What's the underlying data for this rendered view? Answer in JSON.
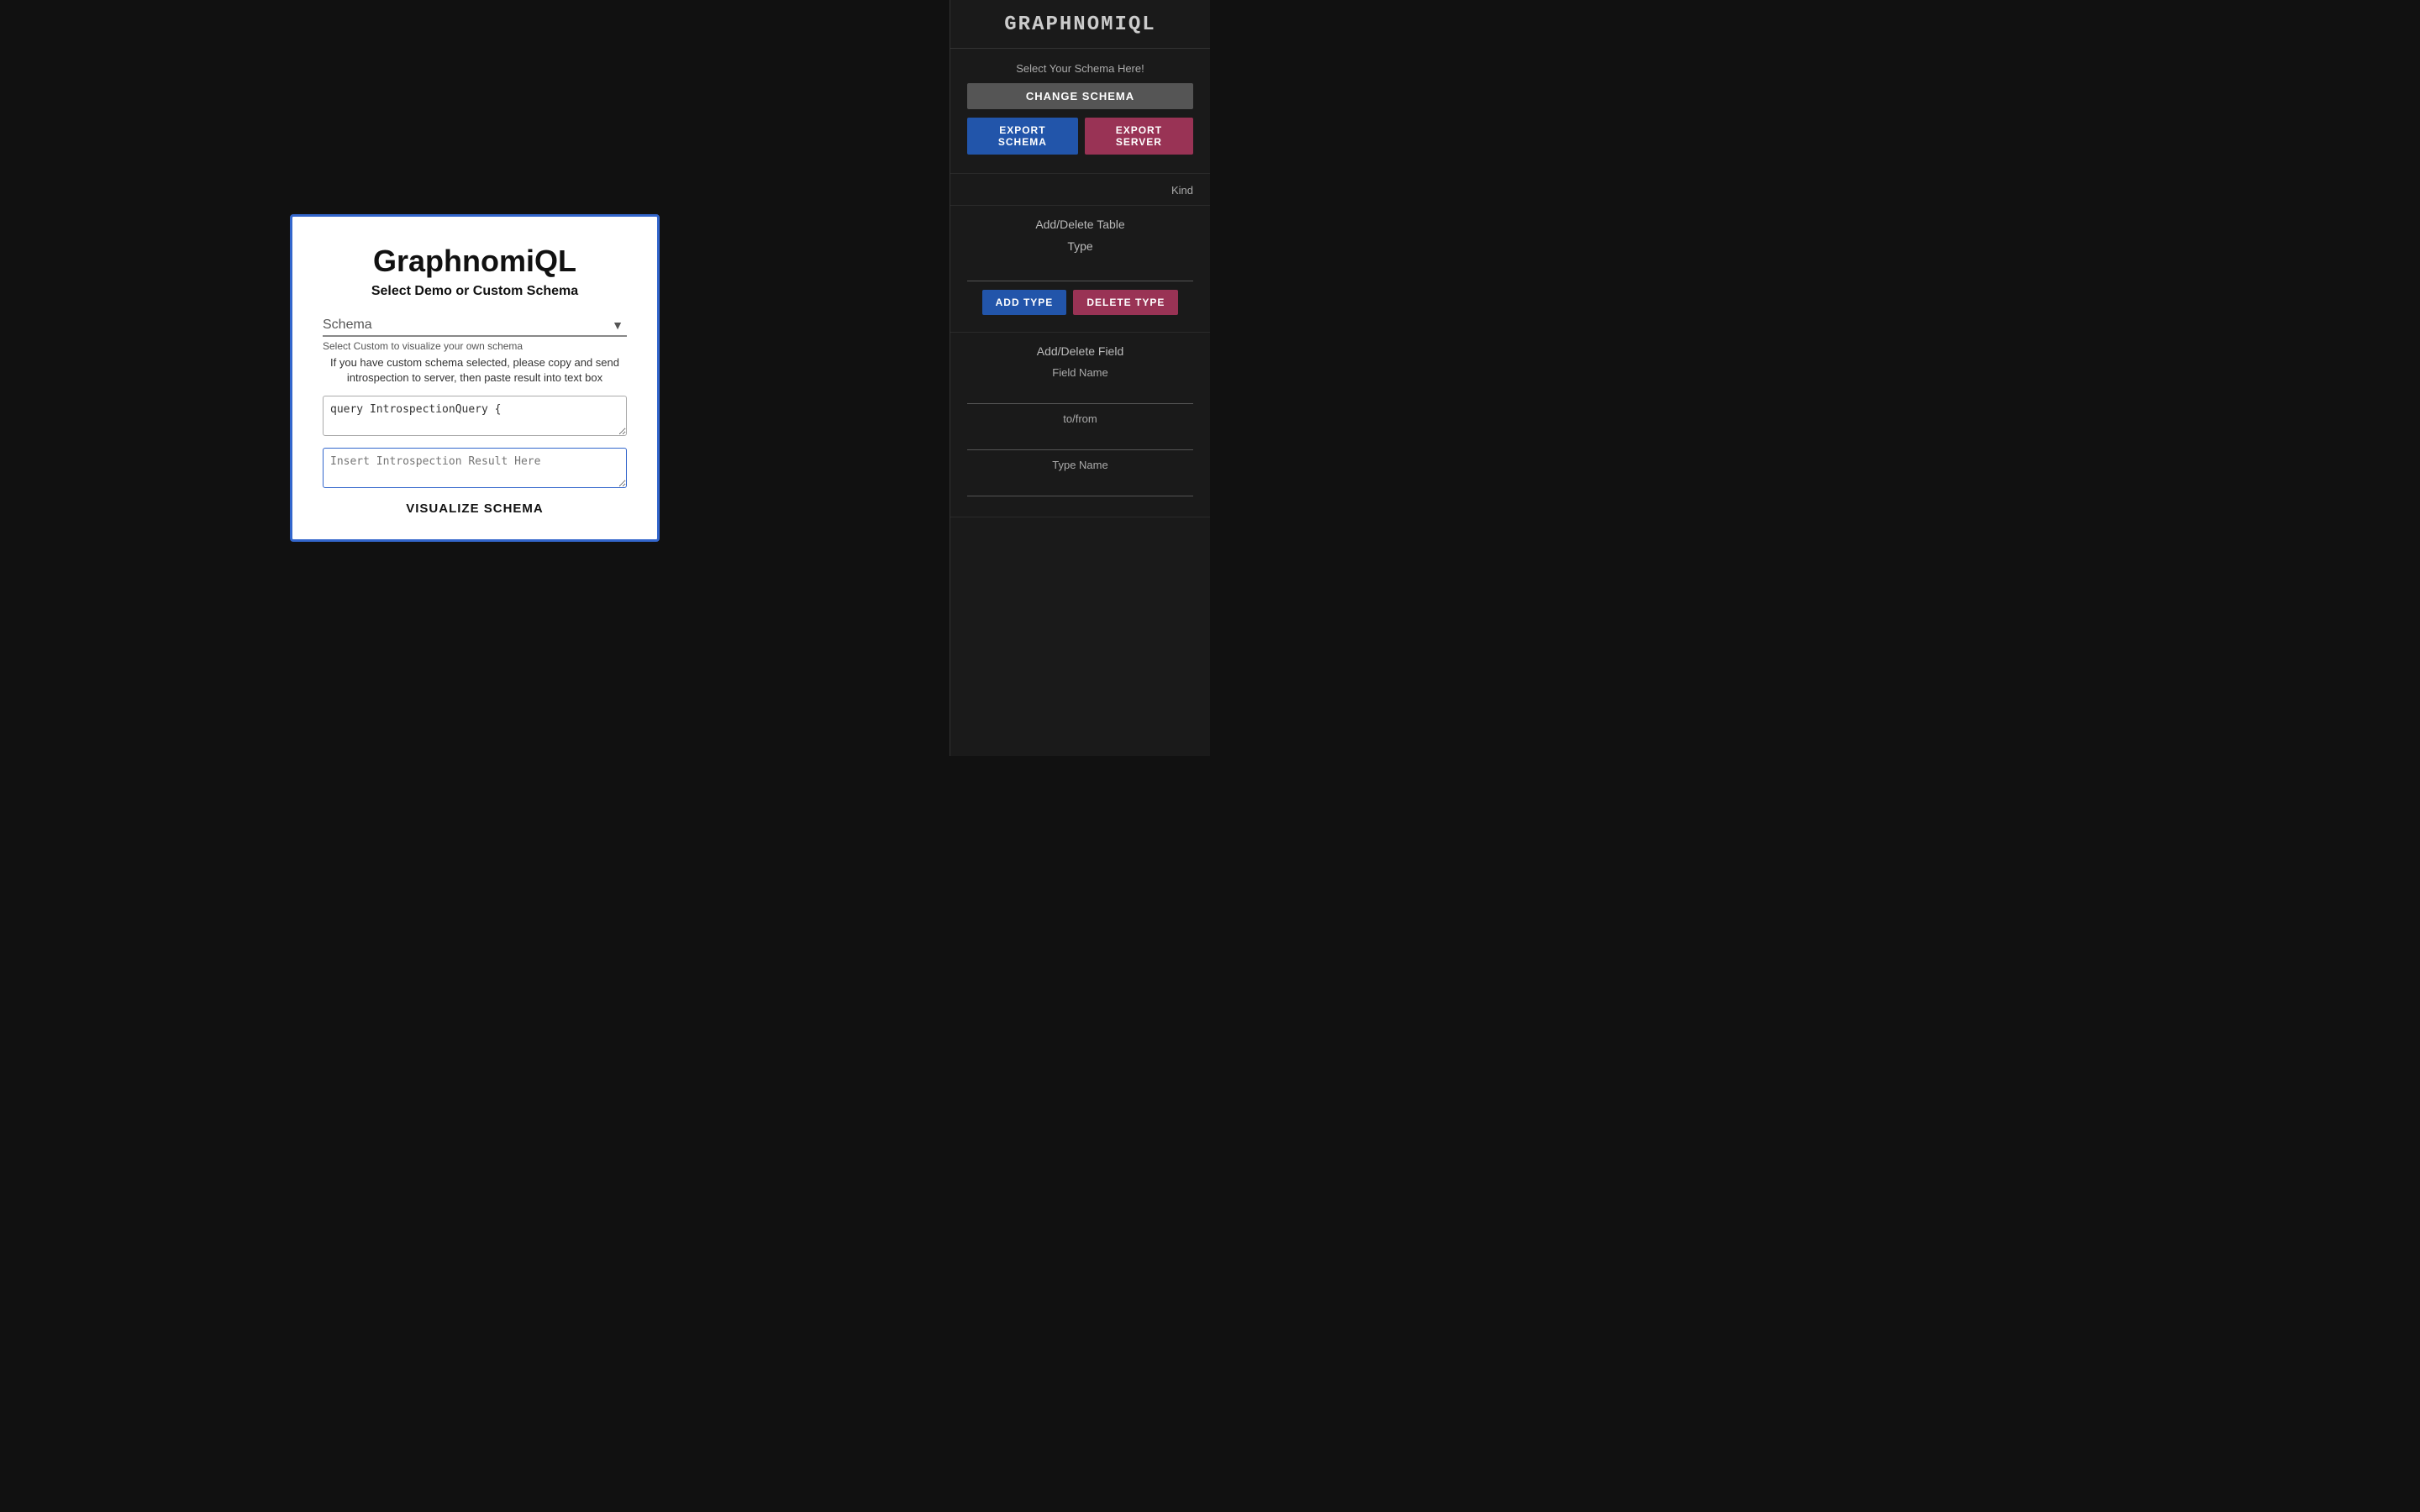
{
  "app": {
    "title": "GRAPHNOMIQL"
  },
  "sidebar": {
    "logo": "GRAPHNOMIQL",
    "schema_section": {
      "label": "Select Your Schema Here!",
      "change_schema_btn": "CHANGE SCHEMA",
      "export_schema_btn": "EXPORT SCHEMA",
      "export_server_btn": "EXPORT SERVER"
    },
    "kind_section": {
      "label": "Kind"
    },
    "type_section": {
      "add_delete_table_label": "Add/Delete Table",
      "type_label": "Type",
      "add_type_btn": "ADD TYPE",
      "delete_type_btn": "DELETE TYPE"
    },
    "field_section": {
      "add_delete_field_label": "Add/Delete Field",
      "field_name_label": "Field Name",
      "to_from_label": "to/from",
      "type_name_label": "Type Name"
    }
  },
  "modal": {
    "title": "GraphnomiQL",
    "subtitle": "Select Demo or Custom Schema",
    "schema_placeholder": "Schema",
    "schema_hint": "Select Custom to visualize your own schema",
    "schema_description": "If you have custom schema selected, please copy and send introspection to server, then paste result into text box",
    "introspection_query": "query IntrospectionQuery {",
    "introspection_placeholder": "Insert Introspection Result Here",
    "visualize_btn": "VISUALIZE SCHEMA"
  }
}
